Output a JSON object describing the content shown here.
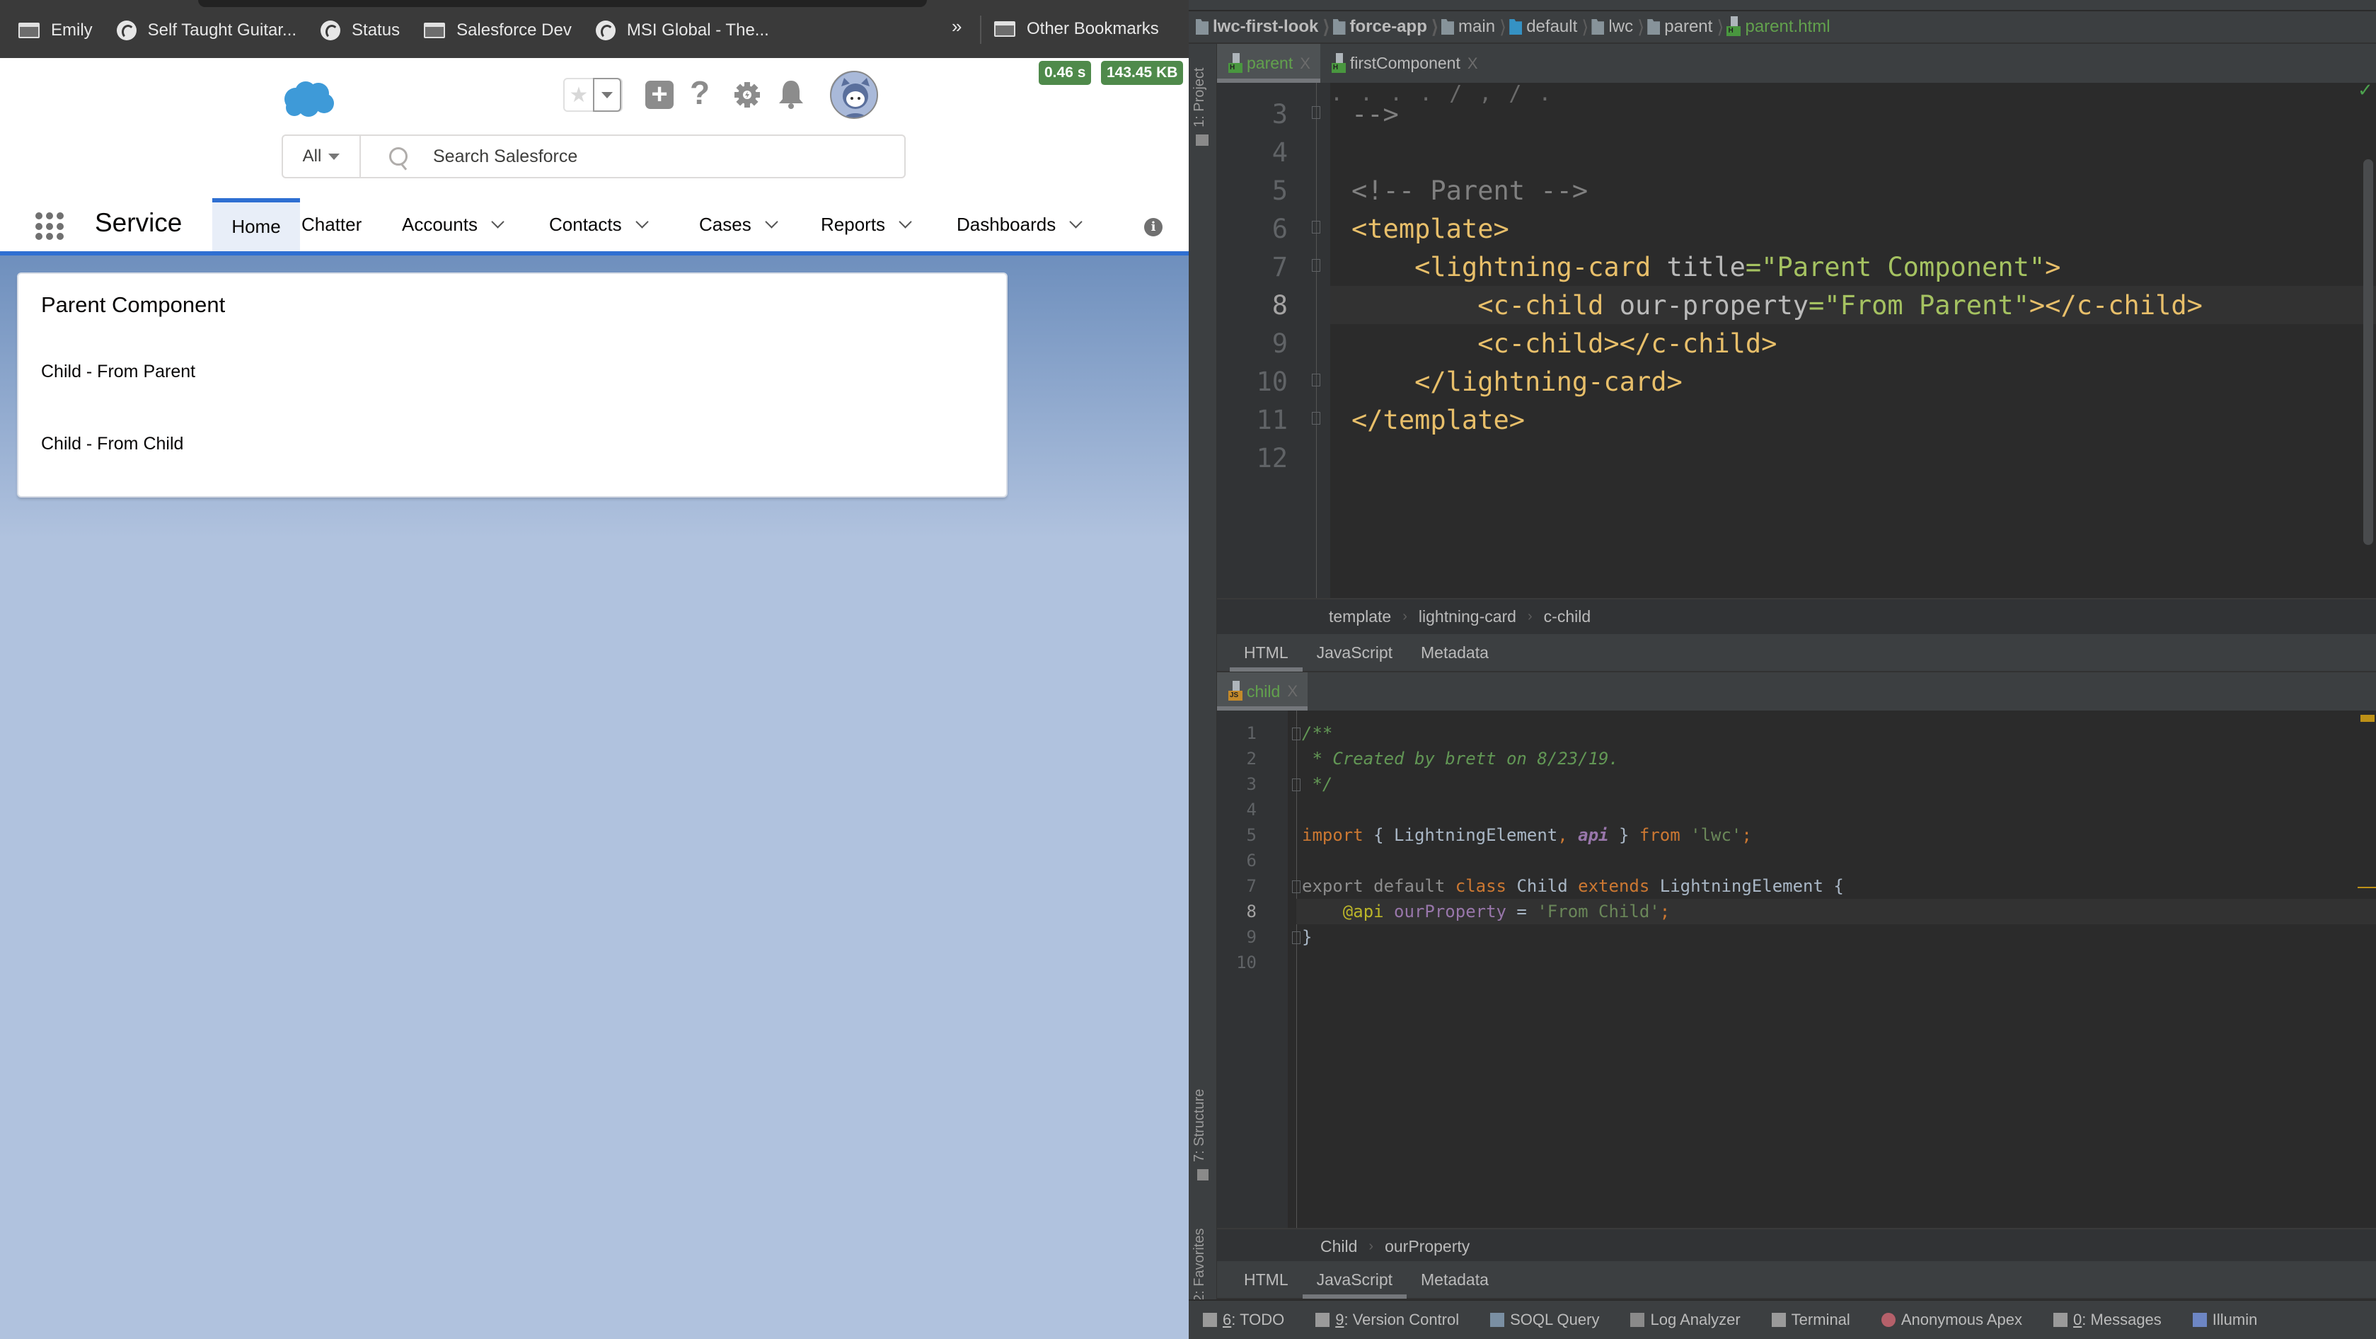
{
  "browser": {
    "bookmarks": [
      {
        "label": "Emily",
        "icon": "folder-icon"
      },
      {
        "label": "Self Taught Guitar...",
        "icon": "globe-icon"
      },
      {
        "label": "Status",
        "icon": "globe-icon"
      },
      {
        "label": "Salesforce Dev",
        "icon": "folder-icon"
      },
      {
        "label": "MSI Global - The...",
        "icon": "globe-icon"
      }
    ],
    "more_label": "»",
    "other_bookmarks": "Other Bookmarks"
  },
  "perf_badges": {
    "time": "0.46 s",
    "size": "143.45 KB"
  },
  "salesforce": {
    "search": {
      "scope": "All",
      "placeholder": "Search Salesforce"
    },
    "header_icons": [
      "favorites-star-icon",
      "favorites-dropdown-icon",
      "global-add-icon",
      "help-icon",
      "setup-gear-icon",
      "notifications-bell-icon",
      "user-avatar"
    ],
    "help_glyph": "?",
    "add_glyph": "+",
    "fav_glyph": "★",
    "app_name": "Service",
    "nav": [
      {
        "label": "Home",
        "active": true,
        "has_menu": false
      },
      {
        "label": "Chatter",
        "active": false,
        "has_menu": false
      },
      {
        "label": "Accounts",
        "active": false,
        "has_menu": true
      },
      {
        "label": "Contacts",
        "active": false,
        "has_menu": true
      },
      {
        "label": "Cases",
        "active": false,
        "has_menu": true
      },
      {
        "label": "Reports",
        "active": false,
        "has_menu": true
      },
      {
        "label": "Dashboards",
        "active": false,
        "has_menu": true
      }
    ],
    "info_glyph": "i",
    "card": {
      "title": "Parent Component",
      "lines": [
        "Child - From Parent",
        "Child - From Child"
      ]
    },
    "colors": {
      "brand_blue": "#2e6fd2",
      "logo_blue": "#3e9ad8",
      "badge_green": "#4f8a4b"
    }
  },
  "ide": {
    "nav_path": [
      {
        "label": "lwc-first-look",
        "bold": true
      },
      {
        "label": "force-app",
        "bold": true
      },
      {
        "label": "main"
      },
      {
        "label": "default",
        "blue": true
      },
      {
        "label": "lwc"
      },
      {
        "label": "parent"
      }
    ],
    "nav_file": "parent.html",
    "side_tabs": {
      "project": "1: Project",
      "structure": "7: Structure",
      "favorites": "2: Favorites"
    },
    "top_tabs": [
      {
        "label": "parent",
        "active": true
      },
      {
        "label": "firstComponent",
        "active": false
      }
    ],
    "close_glyph": "X",
    "html_editor": {
      "current_line": 8,
      "lines": [
        {
          "n": "3",
          "tokens": [
            {
              "t": "-->",
              "c": "t-com"
            }
          ]
        },
        {
          "n": "4",
          "tokens": []
        },
        {
          "n": "5",
          "tokens": [
            {
              "t": "<!-- Parent -->",
              "c": "t-com"
            }
          ]
        },
        {
          "n": "6",
          "tokens": [
            {
              "t": "<template>",
              "c": "t-tag"
            }
          ]
        },
        {
          "n": "7",
          "tokens": [
            {
              "t": "    <lightning-card ",
              "c": "t-tag"
            },
            {
              "t": "title",
              "c": "t-attr"
            },
            {
              "t": "=\"Parent Component\"",
              "c": "t-val"
            },
            {
              "t": ">",
              "c": "t-tag"
            }
          ]
        },
        {
          "n": "8",
          "tokens": [
            {
              "t": "        <c-child ",
              "c": "t-tag"
            },
            {
              "t": "our-property",
              "c": "t-attr"
            },
            {
              "t": "=\"From Parent\"",
              "c": "t-val"
            },
            {
              "t": "></c-child>",
              "c": "t-tag"
            }
          ]
        },
        {
          "n": "9",
          "tokens": [
            {
              "t": "        <c-child></c-child>",
              "c": "t-tag"
            }
          ]
        },
        {
          "n": "10",
          "tokens": [
            {
              "t": "    </lightning-card>",
              "c": "t-tag"
            }
          ]
        },
        {
          "n": "11",
          "tokens": [
            {
              "t": "</template>",
              "c": "t-tag"
            }
          ]
        },
        {
          "n": "12",
          "tokens": []
        }
      ]
    },
    "html_crumbs": [
      "template",
      "lightning-card",
      "c-child"
    ],
    "sub_tabs": [
      "HTML",
      "JavaScript",
      "Metadata"
    ],
    "html_sub_active": "HTML",
    "js_tab": {
      "label": "child"
    },
    "js_editor": {
      "current_line": 8,
      "lines": [
        {
          "n": "1",
          "tokens": [
            {
              "t": "/**",
              "c": "t-doc"
            }
          ]
        },
        {
          "n": "2",
          "tokens": [
            {
              "t": " * Created by brett on 8/23/19.",
              "c": "t-doc"
            }
          ]
        },
        {
          "n": "3",
          "tokens": [
            {
              "t": " */",
              "c": "t-doc"
            }
          ]
        },
        {
          "n": "4",
          "tokens": []
        },
        {
          "n": "5",
          "tokens": [
            {
              "t": "import",
              "c": "t-kw"
            },
            {
              "t": " { LightningElement",
              "c": "t-def"
            },
            {
              "t": ",",
              "c": "t-kw"
            },
            {
              "t": " ",
              "c": "t-def"
            },
            {
              "t": "api",
              "c": "t-api"
            },
            {
              "t": " } ",
              "c": "t-def"
            },
            {
              "t": "from",
              "c": "t-kw"
            },
            {
              "t": " 'lwc'",
              "c": "t-str"
            },
            {
              "t": ";",
              "c": "t-kw"
            }
          ]
        },
        {
          "n": "6",
          "tokens": []
        },
        {
          "n": "7",
          "tokens": [
            {
              "t": "export default ",
              "c": "t-dim"
            },
            {
              "t": "class",
              "c": "t-kw"
            },
            {
              "t": " Child ",
              "c": "t-def"
            },
            {
              "t": "extends",
              "c": "t-kw"
            },
            {
              "t": " LightningElement {",
              "c": "t-def"
            }
          ]
        },
        {
          "n": "8",
          "tokens": [
            {
              "t": "    ",
              "c": "t-def"
            },
            {
              "t": "@api",
              "c": "t-dec"
            },
            {
              "t": " ourProperty",
              "c": "t-prop"
            },
            {
              "t": " = ",
              "c": "t-def"
            },
            {
              "t": "'From Child'",
              "c": "t-str"
            },
            {
              "t": ";",
              "c": "t-kw"
            }
          ]
        },
        {
          "n": "9",
          "tokens": [
            {
              "t": "}",
              "c": "t-def"
            }
          ]
        },
        {
          "n": "10",
          "tokens": []
        }
      ]
    },
    "js_crumbs": [
      "Child",
      "ourProperty"
    ],
    "js_sub_active": "JavaScript",
    "tool_windows": [
      {
        "key": "6",
        "label": ": TODO",
        "icon": "todo-icon"
      },
      {
        "key": "9",
        "label": ": Version Control",
        "icon": "version-control-icon"
      },
      {
        "key": "",
        "label": "SOQL Query",
        "icon": "soql-query-icon"
      },
      {
        "key": "",
        "label": "Log Analyzer",
        "icon": "log-analyzer-icon"
      },
      {
        "key": "",
        "label": "Terminal",
        "icon": "terminal-icon"
      },
      {
        "key": "",
        "label": "Anonymous Apex",
        "icon": "anonymous-apex-icon"
      },
      {
        "key": "0",
        "label": ": Messages",
        "icon": "messages-icon"
      },
      {
        "key": "",
        "label": "Illumin",
        "icon": "illuminated-cloud-icon"
      }
    ],
    "ok_glyph": "✓"
  }
}
